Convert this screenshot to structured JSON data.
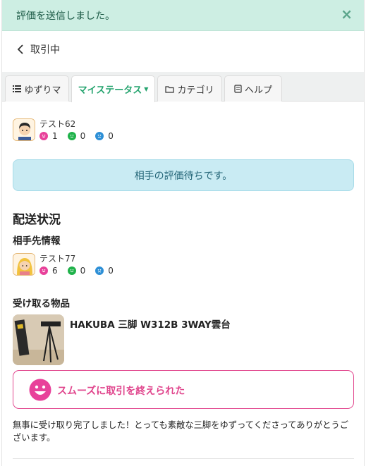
{
  "alert": {
    "message": "評価を送信しました。",
    "close": "×"
  },
  "back": {
    "label": "取引中"
  },
  "tabs": [
    {
      "label": "ゆずりマ",
      "icon": "list-icon"
    },
    {
      "label": "マイステータス",
      "icon": "caret-down-icon",
      "active": true
    },
    {
      "label": "カテゴリ",
      "icon": "folder-icon"
    },
    {
      "label": "ヘルプ",
      "icon": "book-icon"
    }
  ],
  "self_user": {
    "name": "テスト62",
    "good": "1",
    "normal": "0",
    "bad": "0"
  },
  "waiting": {
    "message": "相手の評価待ちです。"
  },
  "shipping": {
    "title": "配送状況",
    "partner_title": "相手先情報",
    "partner": {
      "name": "テスト77",
      "good": "6",
      "normal": "0",
      "bad": "0"
    },
    "item_title": "受け取る物品",
    "item_name": "HAKUBA 三脚 W312B 3WAY雲台"
  },
  "rating": {
    "label": "スムーズに取引を終えられた"
  },
  "comment": "無事に受け取り完了しました！とっても素敵な三脚をゆずってくださってありがとうございます。",
  "colors": {
    "good": "#e8419a",
    "normal": "#1fb24a",
    "bad": "#2d8fd6",
    "accent": "#23a36d"
  }
}
